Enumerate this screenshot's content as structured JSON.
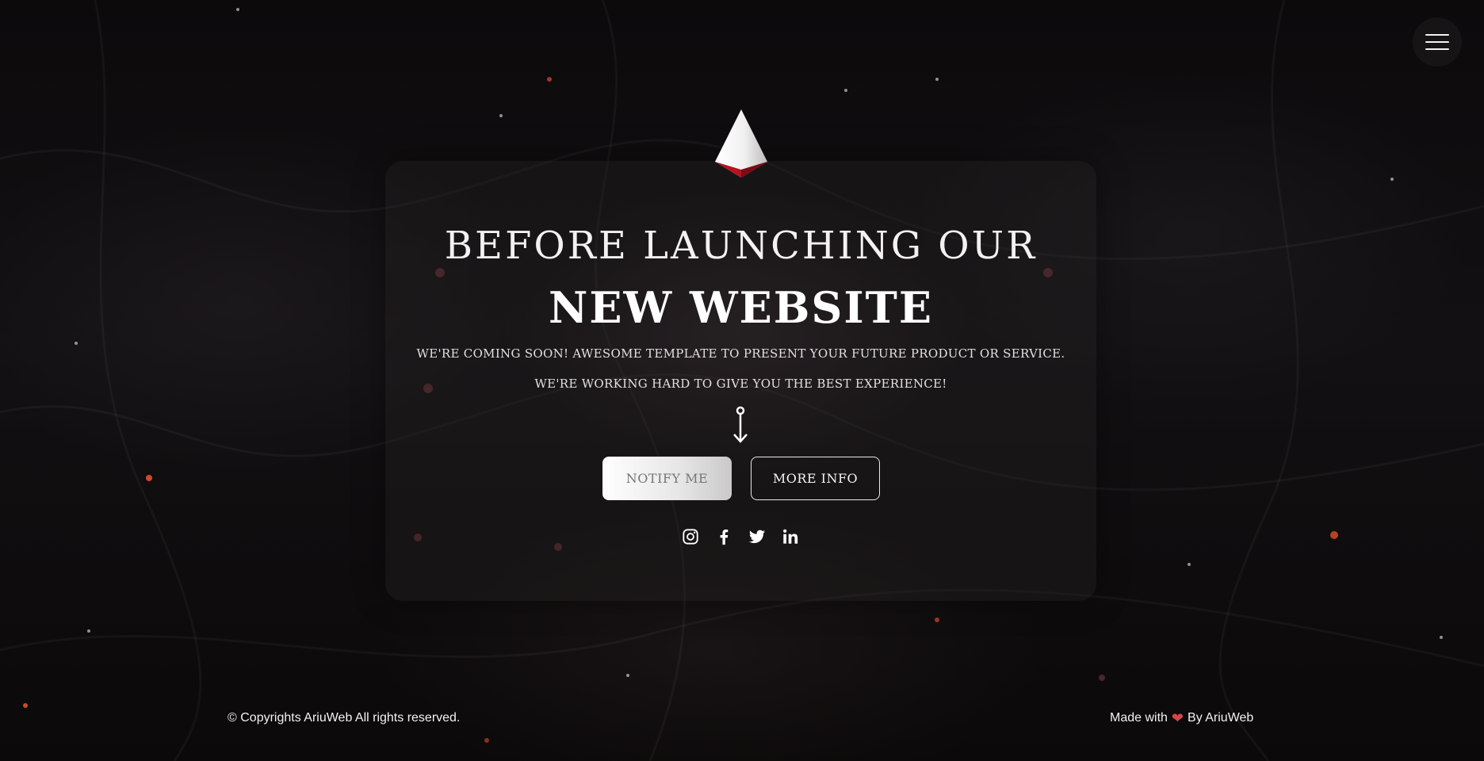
{
  "header": {
    "menu_icon": "hamburger-menu-icon"
  },
  "logo": {
    "icon": "pyramid-logo-icon",
    "colors": {
      "top": "#ffffff",
      "bottom": "#b3141e"
    }
  },
  "hero": {
    "headline_line1": "BEFORE LAUNCHING OUR",
    "headline_line2": "NEW WEBSITE",
    "subtitle_line1": "WE'RE COMING SOON! AWESOME TEMPLATE TO PRESENT YOUR FUTURE PRODUCT OR SERVICE.",
    "subtitle_line2": "WE'RE WORKING HARD TO GIVE YOU THE BEST EXPERIENCE!",
    "arrow_icon": "down-arrow-icon"
  },
  "buttons": {
    "notify_label": "NOTIFY ME",
    "more_info_label": "MORE INFO"
  },
  "socials": [
    {
      "icon": "instagram-icon"
    },
    {
      "icon": "facebook-icon"
    },
    {
      "icon": "twitter-icon"
    },
    {
      "icon": "linkedin-icon"
    }
  ],
  "footer": {
    "copyright": "© Copyrights AriuWeb All rights reserved.",
    "made_with": "Made with",
    "by": "By AriuWeb",
    "heart_icon": "heart-icon",
    "heart_color": "#d64545"
  },
  "colors": {
    "background": "#0b0909",
    "accent": "#b3141e",
    "text": "#f3f1f1"
  }
}
